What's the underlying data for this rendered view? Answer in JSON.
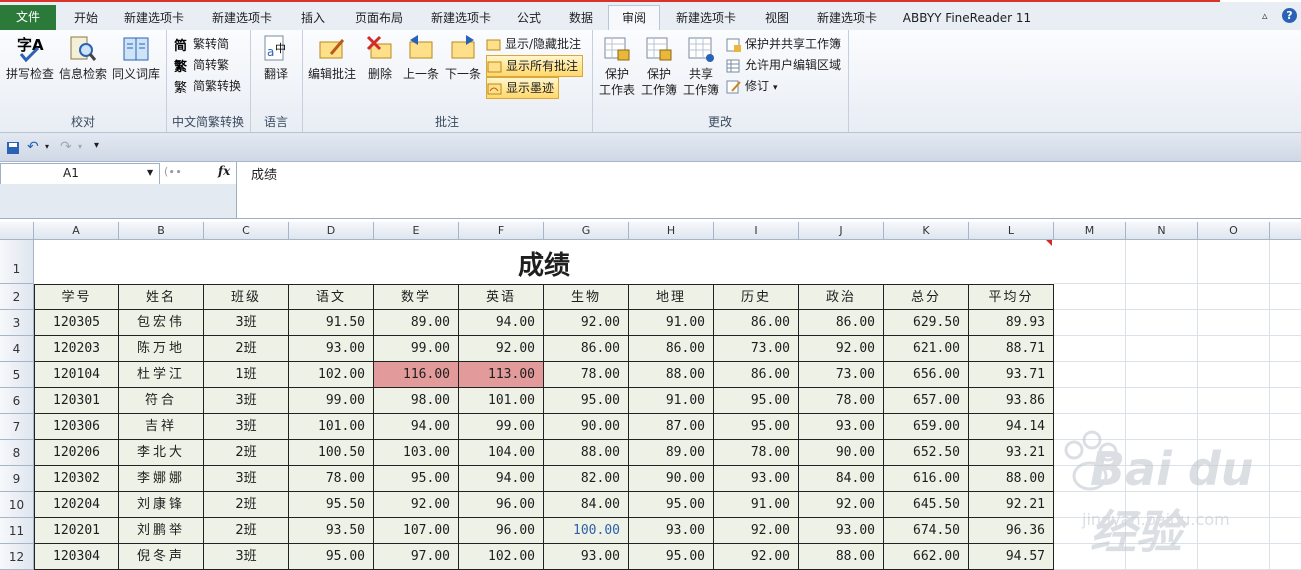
{
  "tabs": [
    "文件",
    "开始",
    "新建选项卡",
    "新建选项卡",
    "插入",
    "页面布局",
    "新建选项卡",
    "公式",
    "数据",
    "审阅",
    "新建选项卡",
    "视图",
    "新建选项卡",
    "ABBYY FineReader 11"
  ],
  "active_tab_index": 9,
  "help_label": "?",
  "ribbon": {
    "proofing": {
      "spell": "拼写检查",
      "research": "信息检索",
      "thesaurus": "同义词库",
      "label": "校对"
    },
    "chinese": {
      "t2s": "繁转简",
      "s2t": "简转繁",
      "convert": "简繁转换",
      "label": "中文简繁转换"
    },
    "language": {
      "translate": "翻译",
      "label": "语言"
    },
    "comments": {
      "edit": "编辑批注",
      "delete": "删除",
      "prev": "上一条",
      "next": "下一条",
      "show_hide": "显示/隐藏批注",
      "show_all": "显示所有批注",
      "show_ink": "显示墨迹",
      "label": "批注"
    },
    "changes": {
      "protect_sheet_1": "保护",
      "protect_sheet_2": "工作表",
      "protect_book_1": "保护",
      "protect_book_2": "工作簿",
      "share_book_1": "共享",
      "share_book_2": "工作簿",
      "protect_share": "保护并共享工作簿",
      "allow_edit": "允许用户编辑区域",
      "track": "修订",
      "label": "更改"
    }
  },
  "formula_bar": {
    "name_box": "A1",
    "fx": "fx",
    "content": "成绩"
  },
  "columns": [
    "A",
    "B",
    "C",
    "D",
    "E",
    "F",
    "G",
    "H",
    "I",
    "J",
    "K",
    "L",
    "M",
    "N",
    "O"
  ],
  "rows": [
    "1",
    "2",
    "3",
    "4",
    "5",
    "6",
    "7",
    "8",
    "9",
    "10",
    "11",
    "12"
  ],
  "sheet_title": "成绩",
  "headers": [
    "学号",
    "姓名",
    "班级",
    "语文",
    "数学",
    "英语",
    "生物",
    "地理",
    "历史",
    "政治",
    "总分",
    "平均分"
  ],
  "table": [
    [
      "120305",
      "包宏伟",
      "3班",
      "91.50",
      "89.00",
      "94.00",
      "92.00",
      "91.00",
      "86.00",
      "86.00",
      "629.50",
      "89.93"
    ],
    [
      "120203",
      "陈万地",
      "2班",
      "93.00",
      "99.00",
      "92.00",
      "86.00",
      "86.00",
      "73.00",
      "92.00",
      "621.00",
      "88.71"
    ],
    [
      "120104",
      "杜学江",
      "1班",
      "102.00",
      "116.00",
      "113.00",
      "78.00",
      "88.00",
      "86.00",
      "73.00",
      "656.00",
      "93.71"
    ],
    [
      "120301",
      "符合",
      "3班",
      "99.00",
      "98.00",
      "101.00",
      "95.00",
      "91.00",
      "95.00",
      "78.00",
      "657.00",
      "93.86"
    ],
    [
      "120306",
      "吉祥",
      "3班",
      "101.00",
      "94.00",
      "99.00",
      "90.00",
      "87.00",
      "95.00",
      "93.00",
      "659.00",
      "94.14"
    ],
    [
      "120206",
      "李北大",
      "2班",
      "100.50",
      "103.00",
      "104.00",
      "88.00",
      "89.00",
      "78.00",
      "90.00",
      "652.50",
      "93.21"
    ],
    [
      "120302",
      "李娜娜",
      "3班",
      "78.00",
      "95.00",
      "94.00",
      "82.00",
      "90.00",
      "93.00",
      "84.00",
      "616.00",
      "88.00"
    ],
    [
      "120204",
      "刘康锋",
      "2班",
      "95.50",
      "92.00",
      "96.00",
      "84.00",
      "95.00",
      "91.00",
      "92.00",
      "645.50",
      "92.21"
    ],
    [
      "120201",
      "刘鹏举",
      "2班",
      "93.50",
      "107.00",
      "96.00",
      "100.00",
      "93.00",
      "92.00",
      "93.00",
      "674.50",
      "96.36"
    ],
    [
      "120304",
      "倪冬声",
      "3班",
      "95.00",
      "97.00",
      "102.00",
      "93.00",
      "95.00",
      "92.00",
      "88.00",
      "662.00",
      "94.57"
    ]
  ],
  "highlight_cells": [
    [
      2,
      4
    ],
    [
      2,
      5
    ]
  ],
  "blue_cells": [
    [
      8,
      6
    ]
  ],
  "colors": {
    "file_tab": "#2c7a3a",
    "cell_fill": "#eef1e6",
    "highlight": "#e39a9a",
    "blue_text": "#2e5fa8"
  },
  "watermark": {
    "logo": "Bai du 经验",
    "url": "jingyan.baidu.com"
  }
}
